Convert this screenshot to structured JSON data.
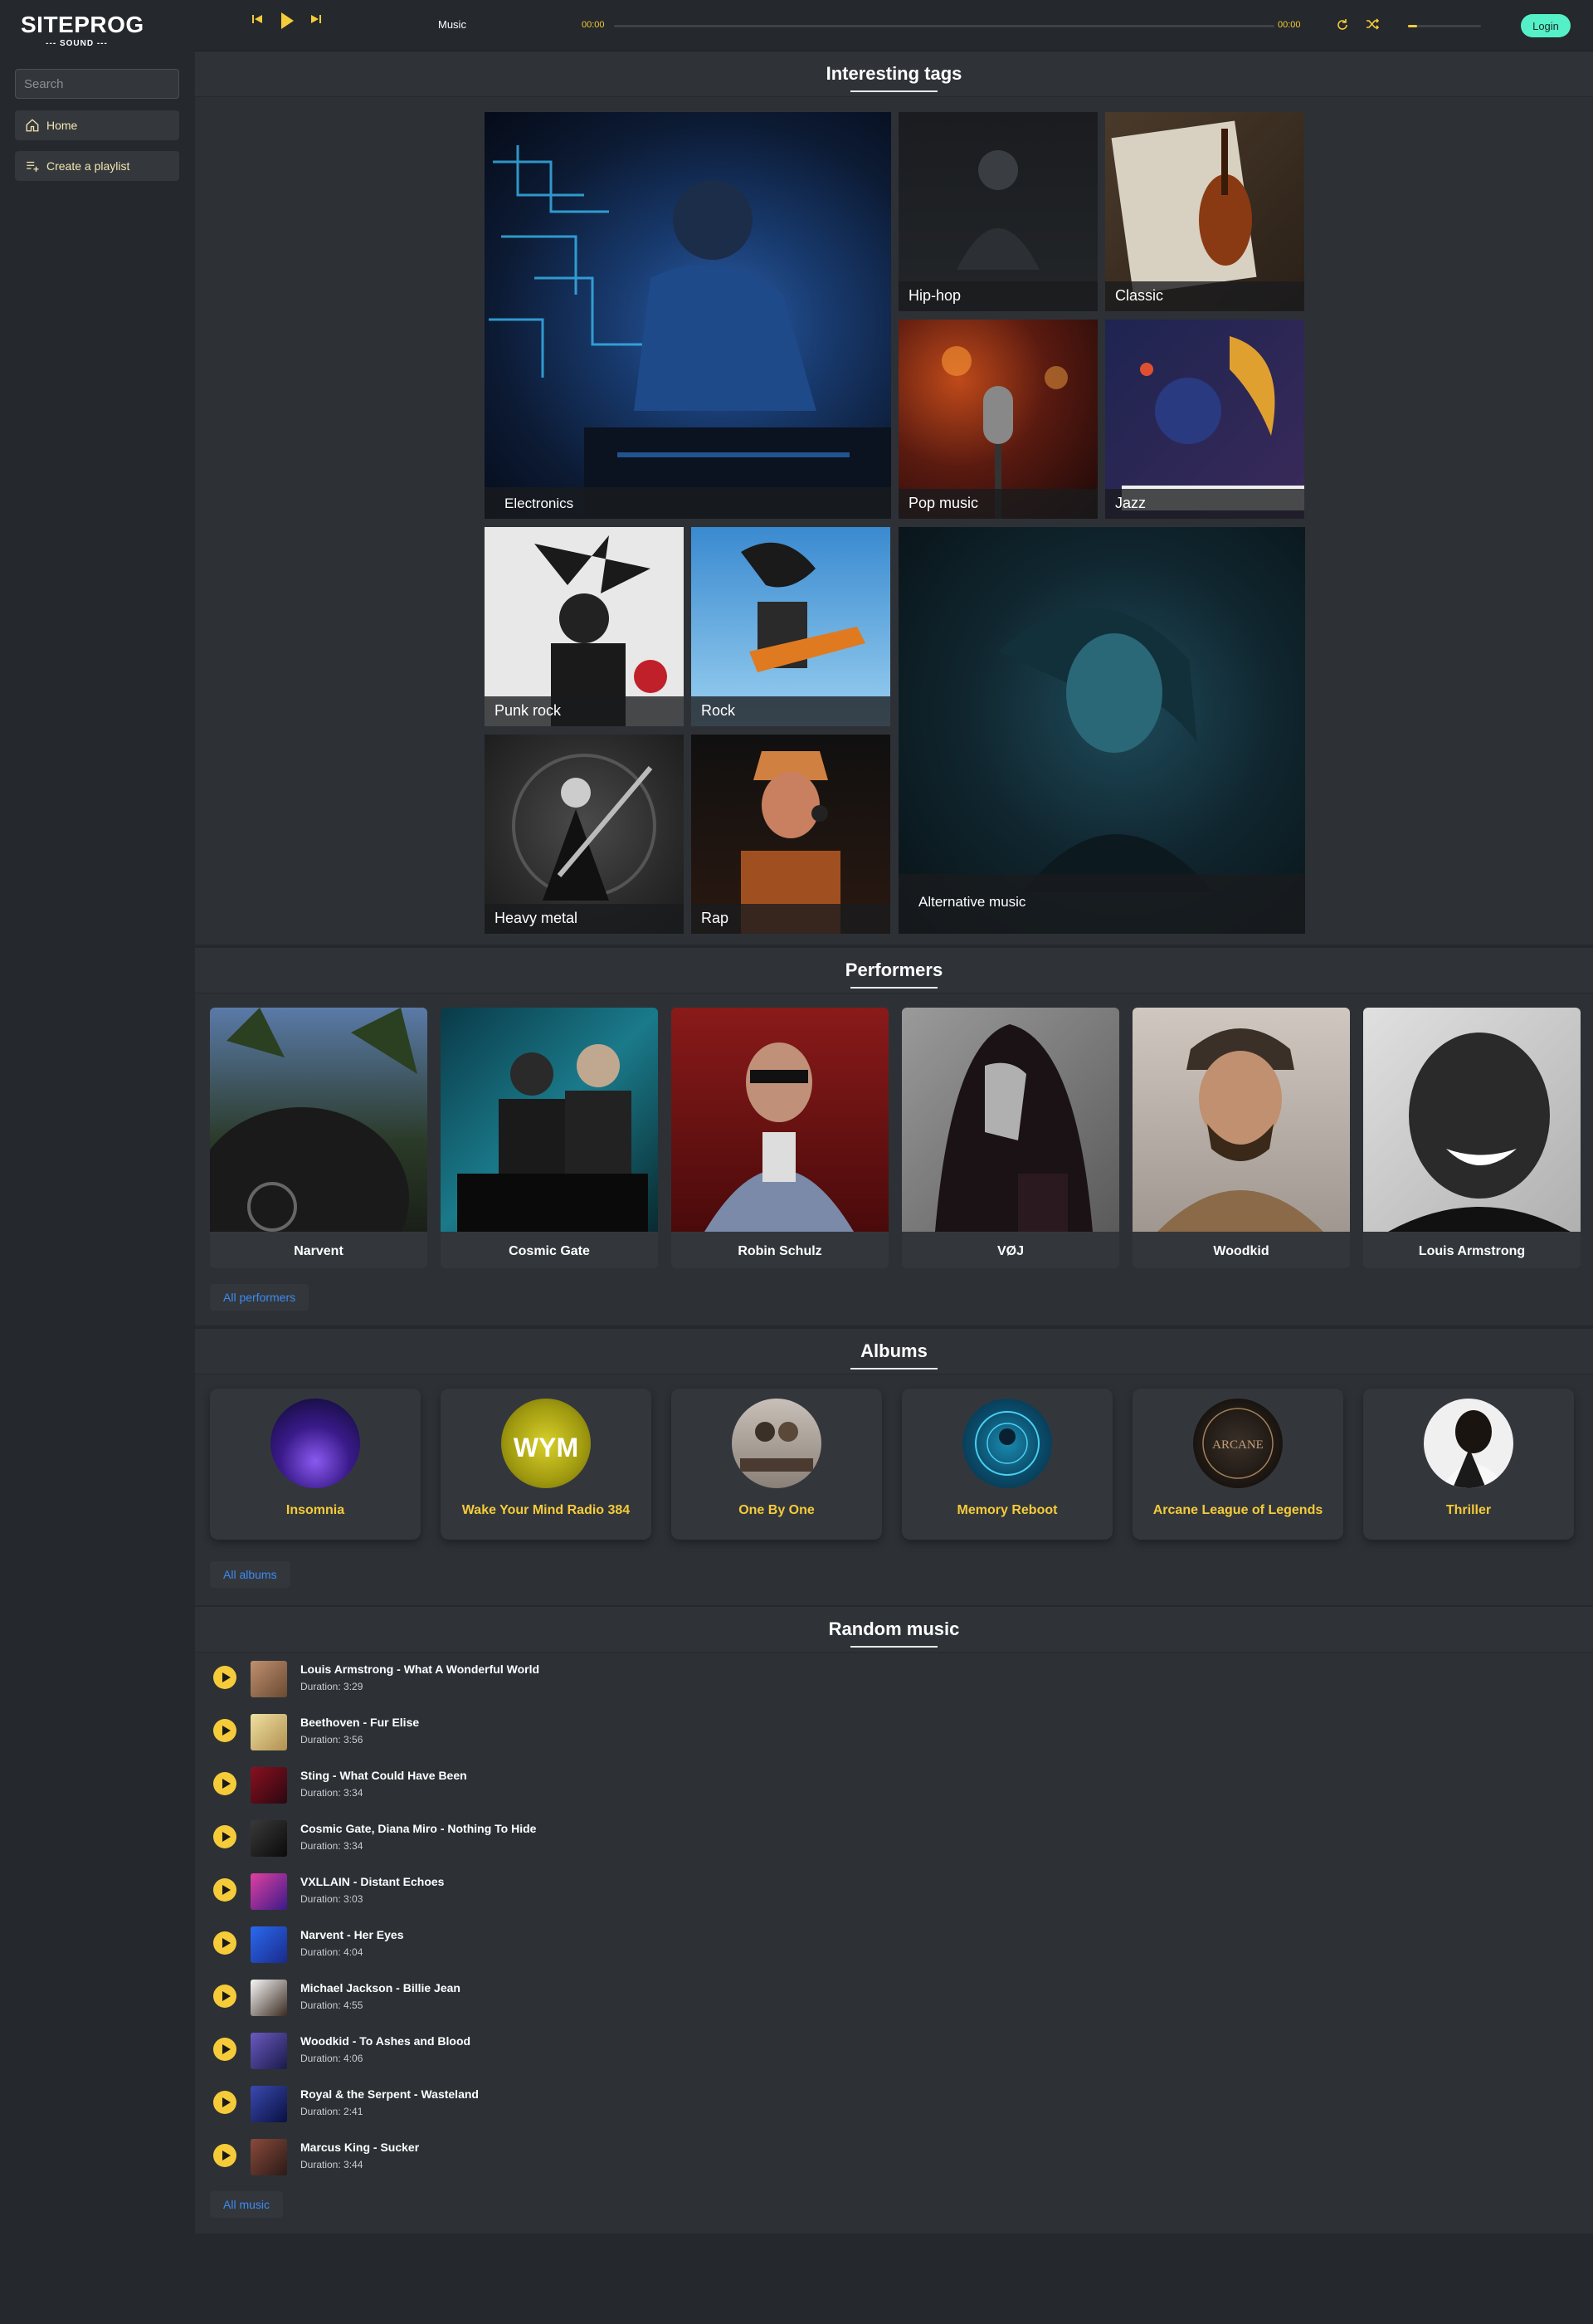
{
  "app": {
    "logo": "SITEPROG",
    "logo_sub": "--- SOUND ---"
  },
  "sidebar": {
    "search_placeholder": "Search",
    "items": [
      {
        "label": "Home",
        "icon": "home-icon"
      },
      {
        "label": "Create a playlist",
        "icon": "playlist-add-icon"
      }
    ]
  },
  "player": {
    "track": "Music",
    "time_current": "00:00",
    "time_total": "00:00",
    "progress": 0,
    "volume": 0.12,
    "login_label": "Login"
  },
  "tags": {
    "title": "Interesting tags",
    "items": [
      {
        "label": "Electronics"
      },
      {
        "label": "Hip-hop"
      },
      {
        "label": "Classic"
      },
      {
        "label": "Pop music"
      },
      {
        "label": "Jazz"
      },
      {
        "label": "Punk rock"
      },
      {
        "label": "Rock"
      },
      {
        "label": "Alternative music"
      },
      {
        "label": "Heavy metal"
      },
      {
        "label": "Rap"
      }
    ]
  },
  "performers": {
    "title": "Performers",
    "items": [
      "Narvent",
      "Cosmic Gate",
      "Robin Schulz",
      "VØJ",
      "Woodkid",
      "Louis Armstrong"
    ],
    "all_label": "All performers"
  },
  "albums": {
    "title": "Albums",
    "items": [
      "Insomnia",
      "Wake Your Mind Radio 384",
      "One By One",
      "Memory Reboot",
      "Arcane League of Legends",
      "Thriller"
    ],
    "all_label": "All albums"
  },
  "random": {
    "title": "Random music",
    "songs": [
      {
        "title": "Louis Armstrong - What A Wonderful World",
        "duration": "Duration: 3:29"
      },
      {
        "title": "Beethoven - Fur Elise",
        "duration": "Duration: 3:56"
      },
      {
        "title": "Sting - What Could Have Been",
        "duration": "Duration: 3:34"
      },
      {
        "title": "Cosmic Gate, Diana Miro - Nothing To Hide",
        "duration": "Duration: 3:34"
      },
      {
        "title": "VXLLAIN - Distant Echoes",
        "duration": "Duration: 3:03"
      },
      {
        "title": "Narvent - Her Eyes",
        "duration": "Duration: 4:04"
      },
      {
        "title": "Michael Jackson - Billie Jean",
        "duration": "Duration: 4:55"
      },
      {
        "title": "Woodkid - To Ashes and Blood",
        "duration": "Duration: 4:06"
      },
      {
        "title": "Royal & the Serpent - Wasteland",
        "duration": "Duration: 2:41"
      },
      {
        "title": "Marcus King - Sucker",
        "duration": "Duration: 3:44"
      }
    ],
    "all_label": "All music"
  },
  "colors": {
    "accent": "#f6cb3a",
    "login": "#55f0c8",
    "link": "#3d8bf2",
    "bg": "#25282c",
    "panel": "#2d3136"
  }
}
